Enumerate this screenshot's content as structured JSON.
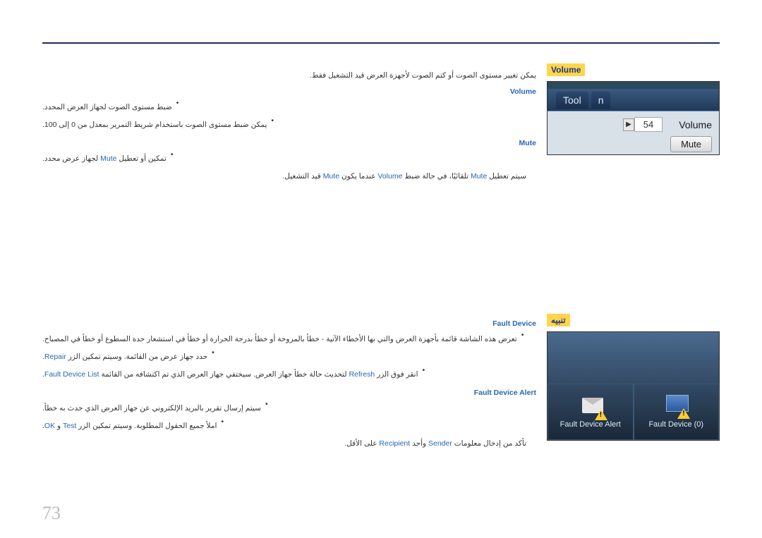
{
  "page_number": "73",
  "section1": {
    "title": "Volume",
    "intro": "يمكن تغيير مستوى الصوت أو كتم الصوت لأجهزة العرض قيد التشغيل فقط.",
    "volume": {
      "label": "Volume",
      "b1": "ضبط مستوى الصوت لجهاز العرض المحدد.",
      "b2": "يمكن ضبط مستوى الصوت باستخدام شريط التمرير بمعدل من 0 إلى 100."
    },
    "mute": {
      "label": "Mute",
      "b1_pre": "تمكين أو تعطيل ",
      "b1_mute": "Mute",
      "b1_post": " لجهاز عرض محدد.",
      "b2_a": "سيتم تعطيل ",
      "b2_b": "Mute",
      "b2_c": " تلقائيًا، في حالة ضبط ",
      "b2_d": "Volume",
      "b2_e": " عندما يكون ",
      "b2_f": "Mute",
      "b2_g": " قيد التشغيل."
    },
    "shot": {
      "tab1": "n",
      "tab2": "Tool",
      "vol_label": "Volume",
      "vol_value": "54",
      "mute_btn": "Mute"
    }
  },
  "section2": {
    "title": "تنبيه",
    "fd": {
      "label": "Fault Device",
      "b1": "تعرض هذه الشاشة قائمة بأجهزة العرض والتي بها الأخطاء الآتية - خطأ بالمروحة أو خطأ بدرجة الحرارة أو خطأ في استشعار حدة السطوع أو خطأ في المصباح.",
      "b2_a": "حدد جهاز عرض من القائمة. وسيتم تمكين الزر ",
      "b2_b": "Repair",
      "b2_c": ".",
      "b3_a": "انقر فوق الزر ",
      "b3_b": "Refresh",
      "b3_c": " لتحديث حالة خطأ جهاز العرض. سيختفي جهاز العرض الذي تم اكتشافه من القائمة ",
      "b3_d": "Fault Device List",
      "b3_e": "."
    },
    "fda": {
      "label": "Fault Device Alert",
      "b1": "سيتم إرسال تقرير بالبريد الإلكتروني عن جهاز العرض الذي حدث به خطأ.",
      "b2_a": "املأ جميع الحقول المطلوبة. وسيتم تمكين الزر ",
      "b2_b": "Test",
      "b2_c": " و ",
      "b2_d": "OK",
      "b2_e": ".",
      "b3_a": "تأكد من إدخال معلومات ",
      "b3_b": "Sender",
      "b3_c": " وأحد ",
      "b3_d": "Recipient",
      "b3_e": " على الأقل."
    },
    "shot": {
      "left_label": "Fault Device (0)",
      "right_label": "Fault Device Alert"
    }
  }
}
